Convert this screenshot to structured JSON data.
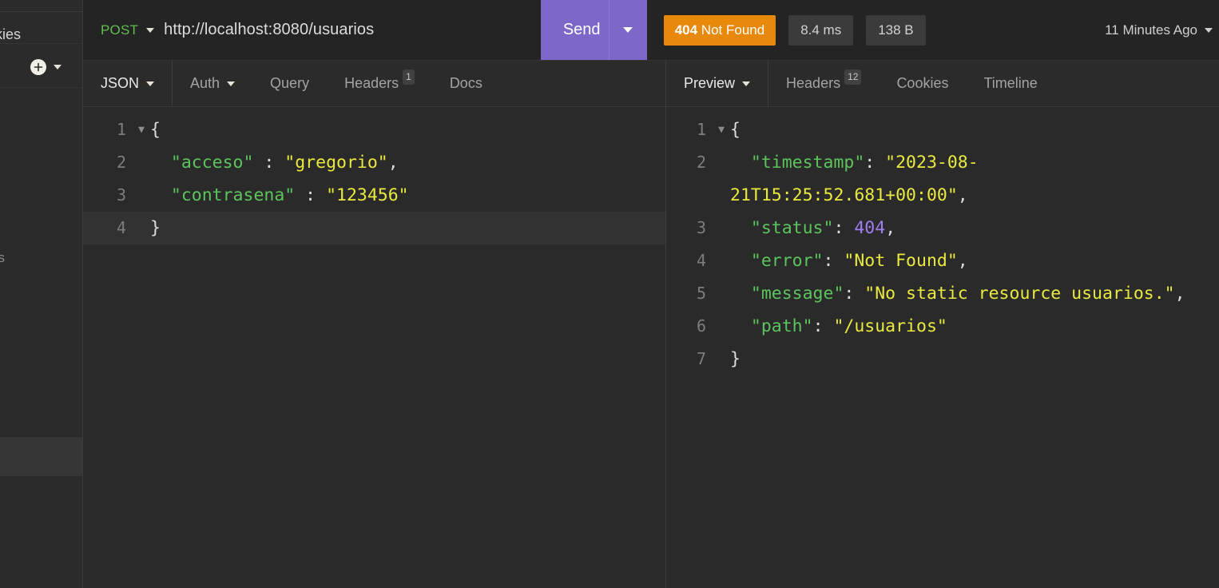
{
  "sidebar": {
    "cookies_label": "okies",
    "add_icon": "plus-circle-icon",
    "dropdown_icon": "chevron-down-icon",
    "item_label": "os"
  },
  "request": {
    "method": "POST",
    "method_dropdown_icon": "chevron-down-icon",
    "url": "http://localhost:8080/usuarios",
    "send_label": "Send",
    "send_dropdown_icon": "chevron-down-icon",
    "tabs": [
      {
        "label": "JSON",
        "badge": "",
        "icon": "chevron-down-icon",
        "active": true
      },
      {
        "label": "Auth",
        "badge": "",
        "icon": "chevron-down-icon",
        "active": false
      },
      {
        "label": "Query",
        "badge": "",
        "icon": "",
        "active": false
      },
      {
        "label": "Headers",
        "badge": "1",
        "icon": "",
        "active": false
      },
      {
        "label": "Docs",
        "badge": "",
        "icon": "",
        "active": false
      }
    ],
    "body_lines": [
      {
        "num": "1",
        "fold": "▼",
        "tokens": [
          {
            "t": "{",
            "c": "p"
          }
        ]
      },
      {
        "num": "2",
        "fold": "",
        "tokens": [
          {
            "t": "  ",
            "c": "p"
          },
          {
            "t": "\"acceso\"",
            "c": "k"
          },
          {
            "t": " : ",
            "c": "c"
          },
          {
            "t": "\"gregorio\"",
            "c": "s"
          },
          {
            "t": ",",
            "c": "p"
          }
        ]
      },
      {
        "num": "3",
        "fold": "",
        "tokens": [
          {
            "t": "  ",
            "c": "p"
          },
          {
            "t": "\"contrasena\"",
            "c": "k"
          },
          {
            "t": " : ",
            "c": "c"
          },
          {
            "t": "\"123456\"",
            "c": "s"
          }
        ]
      },
      {
        "num": "4",
        "fold": "",
        "active": true,
        "tokens": [
          {
            "t": "}",
            "c": "p"
          }
        ]
      }
    ]
  },
  "response": {
    "status_code": "404",
    "status_text": "Not Found",
    "time": "8.4 ms",
    "size": "138 B",
    "time_ago": "11 Minutes Ago",
    "time_ago_icon": "chevron-down-icon",
    "tabs": [
      {
        "label": "Preview",
        "badge": "",
        "icon": "chevron-down-icon",
        "active": true
      },
      {
        "label": "Headers",
        "badge": "12",
        "icon": "",
        "active": false
      },
      {
        "label": "Cookies",
        "badge": "",
        "icon": "",
        "active": false
      },
      {
        "label": "Timeline",
        "badge": "",
        "icon": "",
        "active": false
      }
    ],
    "body_lines": [
      {
        "num": "1",
        "fold": "▼",
        "tokens": [
          {
            "t": "{",
            "c": "p"
          }
        ]
      },
      {
        "num": "2",
        "fold": "",
        "tokens": [
          {
            "t": "  ",
            "c": "p"
          },
          {
            "t": "\"timestamp\"",
            "c": "k"
          },
          {
            "t": ": ",
            "c": "c"
          },
          {
            "t": "\"2023-08-21T15:25:52.681+00:00\"",
            "c": "s"
          },
          {
            "t": ",",
            "c": "p"
          }
        ]
      },
      {
        "num": "3",
        "fold": "",
        "tokens": [
          {
            "t": "  ",
            "c": "p"
          },
          {
            "t": "\"status\"",
            "c": "k"
          },
          {
            "t": ": ",
            "c": "c"
          },
          {
            "t": "404",
            "c": "n"
          },
          {
            "t": ",",
            "c": "p"
          }
        ]
      },
      {
        "num": "4",
        "fold": "",
        "tokens": [
          {
            "t": "  ",
            "c": "p"
          },
          {
            "t": "\"error\"",
            "c": "k"
          },
          {
            "t": ": ",
            "c": "c"
          },
          {
            "t": "\"Not Found\"",
            "c": "s"
          },
          {
            "t": ",",
            "c": "p"
          }
        ]
      },
      {
        "num": "5",
        "fold": "",
        "tokens": [
          {
            "t": "  ",
            "c": "p"
          },
          {
            "t": "\"message\"",
            "c": "k"
          },
          {
            "t": ": ",
            "c": "c"
          },
          {
            "t": "\"No static resource usuarios.\"",
            "c": "s"
          },
          {
            "t": ",",
            "c": "p"
          }
        ]
      },
      {
        "num": "6",
        "fold": "",
        "tokens": [
          {
            "t": "  ",
            "c": "p"
          },
          {
            "t": "\"path\"",
            "c": "k"
          },
          {
            "t": ": ",
            "c": "c"
          },
          {
            "t": "\"/usuarios\"",
            "c": "s"
          }
        ]
      },
      {
        "num": "7",
        "fold": "",
        "tokens": [
          {
            "t": "}",
            "c": "p"
          }
        ]
      }
    ]
  },
  "colors": {
    "accent_send": "#7d68ca",
    "status_error": "#e8890c",
    "method_post": "#62bd4d",
    "json_key": "#5cc45c",
    "json_string": "#e9e93f",
    "json_number": "#a07ef0",
    "background": "#2a2a2a"
  }
}
